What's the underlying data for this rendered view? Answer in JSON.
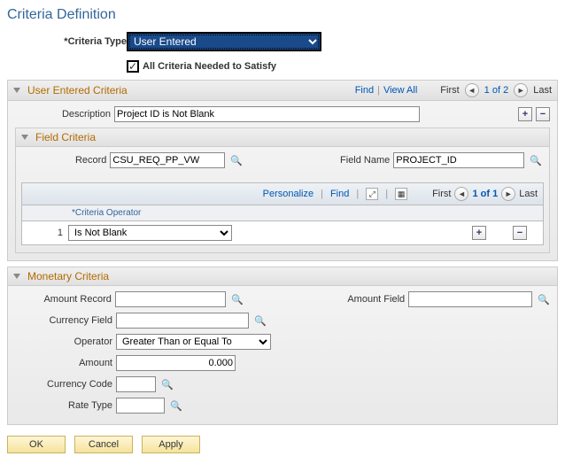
{
  "page": {
    "title": "Criteria Definition"
  },
  "criteria_type": {
    "label": "Criteria Type",
    "value": "User Entered"
  },
  "all_criteria": {
    "label": "All Criteria Needed to Satisfy",
    "checked": true
  },
  "user_entered": {
    "title": "User Entered Criteria",
    "find": "Find",
    "view_all": "View All",
    "first": "First",
    "counter": "1 of 2",
    "last": "Last",
    "description": {
      "label": "Description",
      "value": "Project ID is Not Blank"
    },
    "field_criteria": {
      "title": "Field Criteria",
      "record": {
        "label": "Record",
        "value": "CSU_REQ_PP_VW"
      },
      "field_name": {
        "label": "Field Name",
        "value": "PROJECT_ID"
      },
      "grid": {
        "personalize": "Personalize",
        "find": "Find",
        "first": "First",
        "counter": "1 of 1",
        "last": "Last",
        "col_header": "Criteria Operator",
        "rows": [
          {
            "num": "1",
            "operator": "Is Not Blank"
          }
        ]
      }
    }
  },
  "monetary": {
    "title": "Monetary Criteria",
    "amount_record": {
      "label": "Amount Record",
      "value": ""
    },
    "amount_field": {
      "label": "Amount Field",
      "value": ""
    },
    "currency_field": {
      "label": "Currency Field",
      "value": ""
    },
    "operator": {
      "label": "Operator",
      "value": "Greater Than or Equal To"
    },
    "amount": {
      "label": "Amount",
      "value": "0.000"
    },
    "currency_code": {
      "label": "Currency Code",
      "value": ""
    },
    "rate_type": {
      "label": "Rate Type",
      "value": ""
    }
  },
  "buttons": {
    "ok": "OK",
    "cancel": "Cancel",
    "apply": "Apply"
  }
}
